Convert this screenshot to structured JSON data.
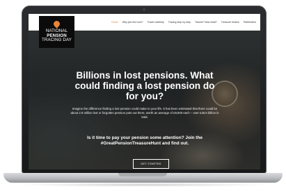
{
  "nav": {
    "items": [
      {
        "label": "Home",
        "active": true
      },
      {
        "label": "Why join the hunt?",
        "active": false
      },
      {
        "label": "Travel carefully",
        "active": false
      },
      {
        "label": "Tracing step by step",
        "active": false
      },
      {
        "label": "Traced? Now what?",
        "active": false
      },
      {
        "label": "Treasure finders",
        "active": false
      },
      {
        "label": "Pathfinders",
        "active": false
      }
    ]
  },
  "logo": {
    "line1": "NATIONAL",
    "line2": "PENSION",
    "line3": "TRACING DAY"
  },
  "hero": {
    "title": "Billions in lost pensions. What could finding a lost pension do for you?",
    "body": "Imagine the difference finding a lost pension could make to your life. It has been estimated that there could be about 2.8 million lost or forgotten pension pots out there, worth an average of £9,500 each – over £26.6 billion in total.",
    "cta_text": "Is it time to pay your pension some attention? Join the #GreatPensionTreasureHunt and find out.",
    "button_label": "GET STARTED"
  },
  "colors": {
    "accent": "#e8853a",
    "logo_bg": "#0b0b0b"
  }
}
